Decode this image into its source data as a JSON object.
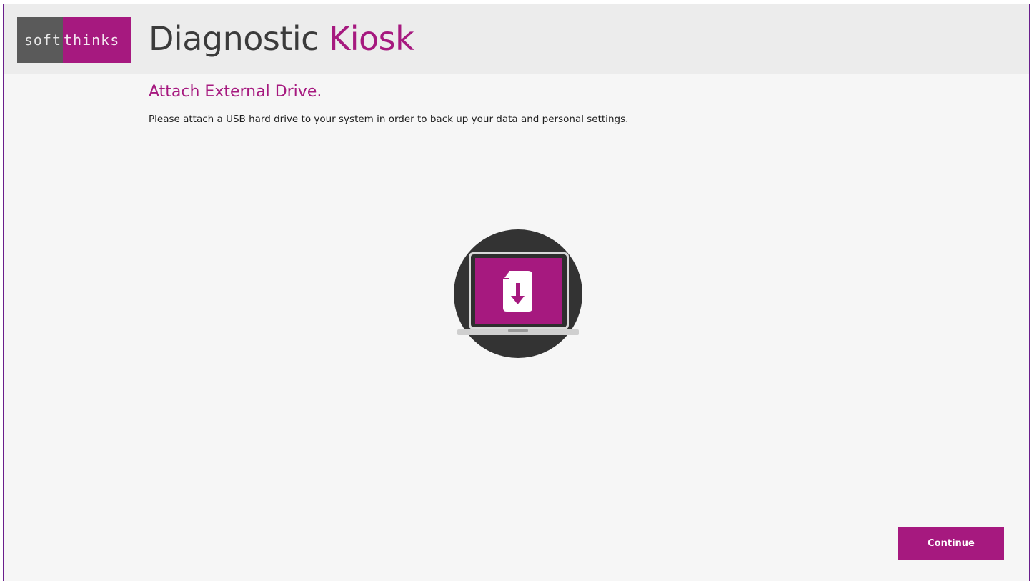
{
  "logo": {
    "left_text": "soft",
    "right_text": "thinks"
  },
  "header": {
    "title_main": "Diagnostic ",
    "title_accent": "Kiosk"
  },
  "step": {
    "heading": "Attach External Drive.",
    "instruction": "Please attach a USB hard drive to your system in order to back up your data and personal settings."
  },
  "illustration": {
    "icon": "laptop-download-icon"
  },
  "footer": {
    "continue_label": "Continue"
  },
  "colors": {
    "accent": "#a6197f",
    "header_bg": "#ececec",
    "page_bg": "#f6f6f6",
    "logo_gray": "#5a5a5a",
    "dark_circle": "#333333"
  }
}
